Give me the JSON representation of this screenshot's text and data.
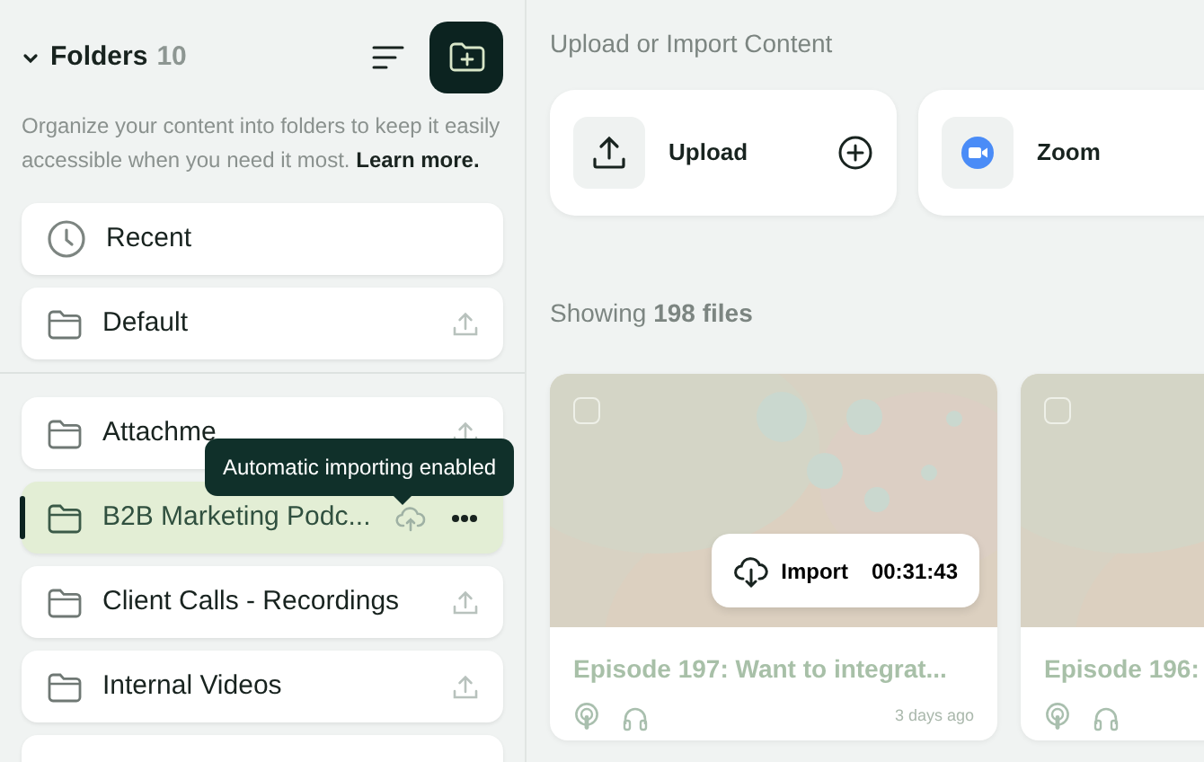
{
  "sidebar": {
    "title": "Folders",
    "count": "10",
    "description": "Organize your content into folders to keep it easily accessible when you need it most.",
    "learn_more": "Learn more.",
    "pinned": [
      {
        "label": "Recent",
        "kind": "recent",
        "selected": false
      },
      {
        "label": "Default",
        "kind": "folder",
        "selected": false
      }
    ],
    "folders": [
      {
        "label": "Attachme",
        "kind": "folder",
        "selected": false
      },
      {
        "label": "B2B Marketing Podc...",
        "kind": "auto-import",
        "selected": true
      },
      {
        "label": "Client Calls - Recordings",
        "kind": "folder",
        "selected": false
      },
      {
        "label": "Internal Videos",
        "kind": "folder",
        "selected": false
      }
    ],
    "tooltip": "Automatic importing enabled"
  },
  "import": {
    "heading": "Upload or Import Content",
    "sources": [
      {
        "label": "Upload",
        "kind": "upload"
      },
      {
        "label": "Zoom",
        "kind": "zoom"
      }
    ]
  },
  "files": {
    "summary": "Showing **198 files**",
    "items": [
      {
        "title": "Episode 197: Want to integrat...",
        "import_label": "Import",
        "duration": "00:31:43",
        "age": "3 days ago",
        "checked": false
      },
      {
        "title": "Episode 196:",
        "checked": false
      }
    ]
  }
}
